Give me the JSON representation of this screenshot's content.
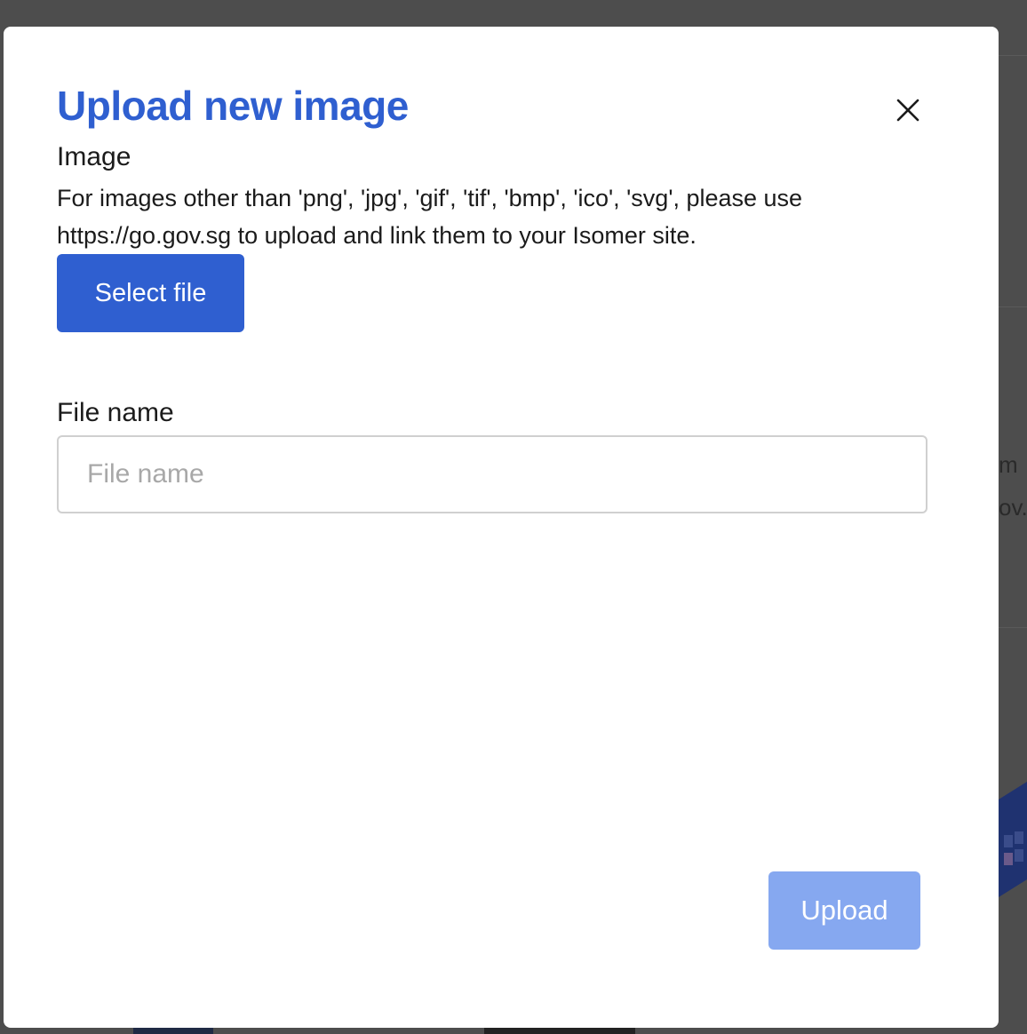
{
  "modal": {
    "title": "Upload new image",
    "close_icon": "close-icon",
    "image_label": "Image",
    "image_help": "For images other than 'png', 'jpg', 'gif', 'tif', 'bmp', 'ico', 'svg', please use https://go.gov.sg to upload and link them to your Isomer site.",
    "select_file_label": "Select file",
    "file_name_label": "File name",
    "file_name_placeholder": "File name",
    "file_name_value": "",
    "upload_label": "Upload"
  },
  "background": {
    "fragment_1": "m",
    "fragment_2": "ov."
  },
  "colors": {
    "accent": "#2f5fd0",
    "upload_disabled": "#86a8f0",
    "overlay": "#4d4d4d"
  }
}
